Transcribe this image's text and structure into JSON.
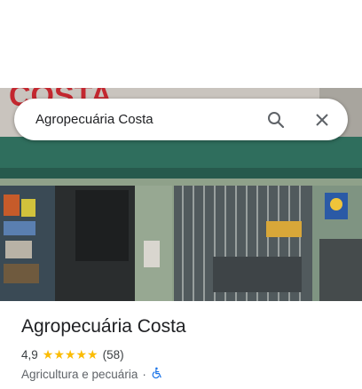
{
  "search": {
    "query": "Agropecuária Costa",
    "search_icon": "search-icon",
    "clear_icon": "close-icon"
  },
  "photo": {
    "sign_text": "COSTA",
    "description_icon": "storefront-photo"
  },
  "place": {
    "name": "Agropecuária Costa",
    "rating": "4,9",
    "stars": 5,
    "review_count": "(58)",
    "category": "Agricultura e pecuária",
    "separator": "·",
    "accessibility_icon": "wheelchair-icon"
  },
  "colors": {
    "star": "#fbbc04",
    "accessibility": "#1a73e8",
    "title": "#202124",
    "secondary": "#5f6368"
  }
}
